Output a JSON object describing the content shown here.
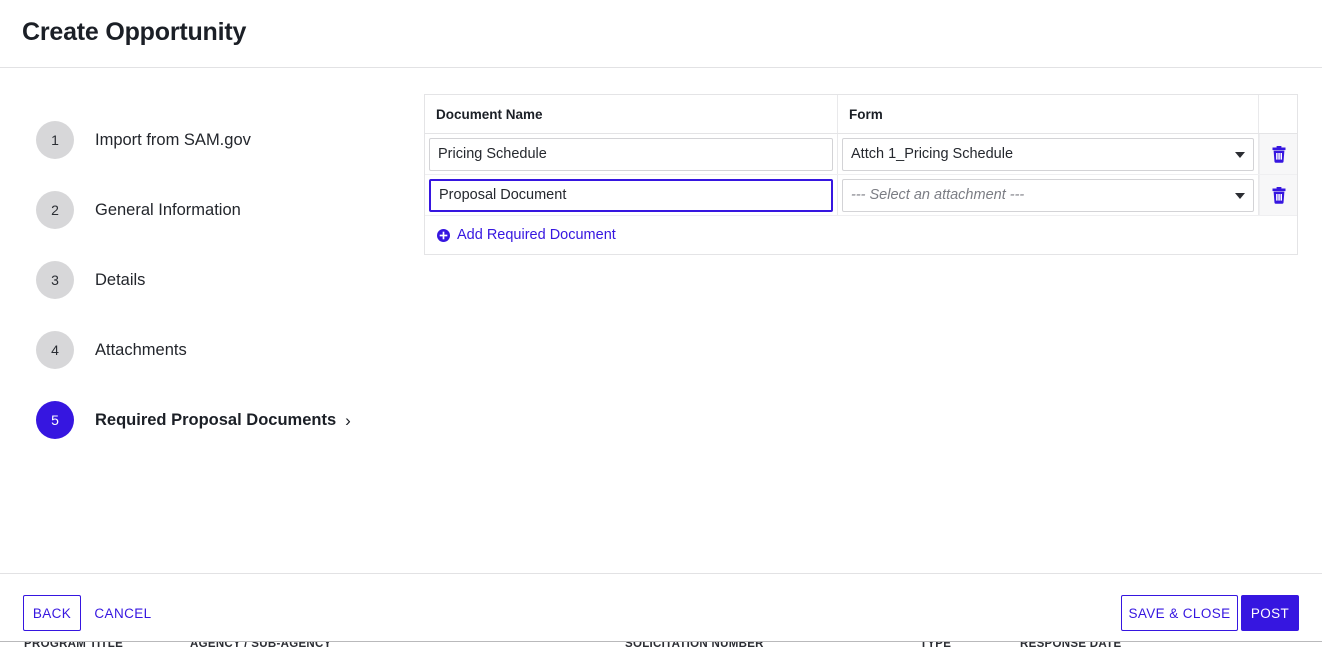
{
  "header": {
    "title": "Create Opportunity"
  },
  "stepper": {
    "steps": [
      {
        "number": "1",
        "label": "Import from SAM.gov",
        "active": false
      },
      {
        "number": "2",
        "label": "General Information",
        "active": false
      },
      {
        "number": "3",
        "label": "Details",
        "active": false
      },
      {
        "number": "4",
        "label": "Attachments",
        "active": false
      },
      {
        "number": "5",
        "label": "Required Proposal Documents",
        "active": true,
        "chevron": "›"
      }
    ]
  },
  "documents_table": {
    "columns": {
      "document_name": "Document Name",
      "form": "Form",
      "actions": ""
    },
    "rows": [
      {
        "document_name": "Pricing Schedule",
        "form_value": "Attch 1_Pricing Schedule",
        "form_is_placeholder": false,
        "name_focused": false,
        "delete_icon": "trash-icon"
      },
      {
        "document_name": "Proposal Document",
        "form_value": "--- Select an attachment ---",
        "form_is_placeholder": true,
        "name_focused": true,
        "delete_icon": "trash-icon"
      }
    ],
    "add_link": {
      "label": "Add Required Document",
      "icon": "plus-circle-icon"
    }
  },
  "footer": {
    "back_label": "BACK",
    "cancel_label": "CANCEL",
    "save_close_label": "SAVE & CLOSE",
    "post_label": "POST"
  },
  "background_sliver": {
    "col1": "PROGRAM TITLE",
    "col2": "AGENCY / SUB-AGENCY",
    "col3": "SOLICITATION NUMBER",
    "col4": "TYPE",
    "col5": "RESPONSE DATE"
  },
  "colors": {
    "accent": "#3616e0",
    "step_inactive": "#d7d7d9",
    "border": "#e4e4e6",
    "text": "#1b1f26",
    "placeholder_text": "#7b7d84",
    "action_cell_bg": "#f7f7f8"
  }
}
